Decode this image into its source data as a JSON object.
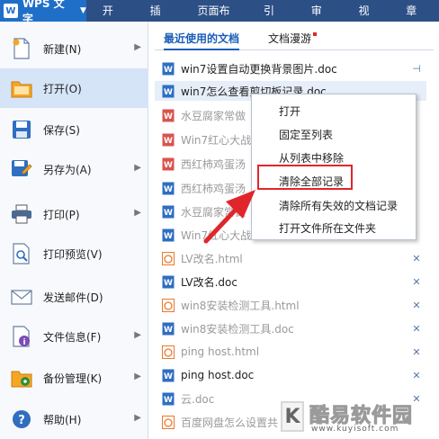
{
  "app": {
    "title": "WPS 文字",
    "logo_letter": "W"
  },
  "menu_tabs": [
    "开始",
    "插入",
    "页面布局",
    "引用",
    "审阅",
    "视图",
    "章节"
  ],
  "left_menu": [
    {
      "label": "新建(N)",
      "icon": "new-doc-icon",
      "has_arrow": true
    },
    {
      "label": "打开(O)",
      "icon": "open-folder-icon",
      "has_arrow": false,
      "active": true
    },
    {
      "label": "保存(S)",
      "icon": "save-icon",
      "has_arrow": false
    },
    {
      "label": "另存为(A)",
      "icon": "save-as-icon",
      "has_arrow": true
    },
    {
      "label": "打印(P)",
      "icon": "print-icon",
      "has_arrow": true
    },
    {
      "label": "打印预览(V)",
      "icon": "print-preview-icon",
      "has_arrow": false
    },
    {
      "label": "发送邮件(D)",
      "icon": "mail-icon",
      "has_arrow": false
    },
    {
      "label": "文件信息(F)",
      "icon": "file-info-icon",
      "has_arrow": true
    },
    {
      "label": "备份管理(K)",
      "icon": "backup-icon",
      "has_arrow": true
    },
    {
      "label": "帮助(H)",
      "icon": "help-icon",
      "has_arrow": true
    }
  ],
  "tabs": {
    "recent": "最近使用的文档",
    "roaming": "文档漫游"
  },
  "files": [
    {
      "name": "win7设置自动更换背景图片.doc",
      "type": "doc",
      "gray": false,
      "action": "pin"
    },
    {
      "name": "win7怎么查看剪切板记录.doc",
      "type": "doc",
      "gray": false,
      "action": ""
    },
    {
      "name": "水豆腐家常做",
      "type": "doc-red",
      "gray": true,
      "action": ""
    },
    {
      "name": "Win7红心大战",
      "type": "doc-red",
      "gray": true,
      "action": ""
    },
    {
      "name": "西红柿鸡蛋汤",
      "type": "doc-red",
      "gray": true,
      "action": ""
    },
    {
      "name": "西红柿鸡蛋汤",
      "type": "doc",
      "gray": true,
      "action": ""
    },
    {
      "name": "水豆腐家常做",
      "type": "doc",
      "gray": true,
      "action": ""
    },
    {
      "name": "Win7红心大战",
      "type": "doc",
      "gray": true,
      "action": ""
    },
    {
      "name": "LV改名.html",
      "type": "html",
      "gray": true,
      "action": "x"
    },
    {
      "name": "LV改名.doc",
      "type": "doc",
      "gray": false,
      "action": "x"
    },
    {
      "name": "win8安装检测工具.html",
      "type": "html",
      "gray": true,
      "action": "x"
    },
    {
      "name": "win8安装检测工具.doc",
      "type": "doc",
      "gray": true,
      "action": "x"
    },
    {
      "name": "ping host.html",
      "type": "html",
      "gray": true,
      "action": "x"
    },
    {
      "name": "ping host.doc",
      "type": "doc",
      "gray": false,
      "action": "x"
    },
    {
      "name": "云.doc",
      "type": "doc",
      "gray": true,
      "action": "x"
    },
    {
      "name": "百度网盘怎么设置共",
      "type": "html",
      "gray": true,
      "action": ""
    }
  ],
  "context_menu": [
    "打开",
    "固定至列表",
    "从列表中移除",
    "清除全部记录",
    "清除所有失效的文档记录",
    "打开文件所在文件夹"
  ],
  "watermark": {
    "letter": "K",
    "text": "酷易软件园",
    "url": "www.kuyisoft.com"
  },
  "colors": {
    "topbar": "#2c4f86",
    "accent": "#1a5db8",
    "highlight_red": "#e0262b"
  }
}
